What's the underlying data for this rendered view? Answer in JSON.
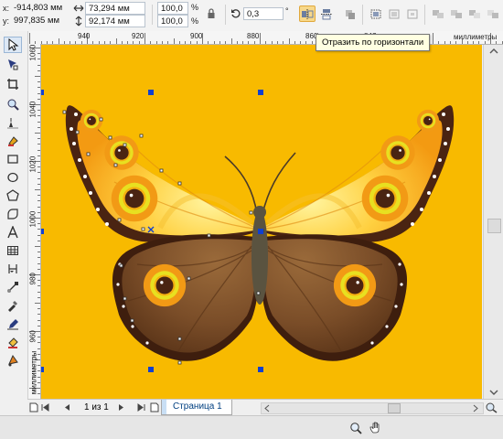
{
  "propbar": {
    "x_label": "x:",
    "x_value": "-914,803 мм",
    "y_label": "y:",
    "y_value": "997,835 мм",
    "width_value": "73,294 мм",
    "height_value": "92,174 мм",
    "scale_x_value": "100,0",
    "scale_y_value": "100,0",
    "percent": "%",
    "rotation_value": "0,3",
    "rotation_unit": "°"
  },
  "tooltip": {
    "text": "Отразить по горизонтали"
  },
  "ruler": {
    "h_ticks": [
      "940",
      "920",
      "900",
      "880",
      "860",
      "840"
    ],
    "units": "миллиметры",
    "v_ticks": [
      "1060",
      "1040",
      "1020",
      "1000",
      "980",
      "960"
    ],
    "v_units": "миллиметры"
  },
  "pagebar": {
    "page_counter": "1 из 1",
    "page_tab": "Страница 1"
  },
  "colors": {
    "canvas": "#f8ba00",
    "selection": "#1040d0",
    "tooltip_bg": "#ffffe1",
    "active_button": "#f7d88a"
  },
  "icons": {
    "toolbox": [
      "pick-tool-icon",
      "shape-tool-icon",
      "crop-tool-icon",
      "zoom-tool-icon",
      "freehand-tool-icon",
      "smart-fill-icon",
      "rectangle-tool-icon",
      "ellipse-tool-icon",
      "polygon-tool-icon",
      "text-tool-icon",
      "table-tool-icon",
      "dimension-tool-icon",
      "connector-tool-icon",
      "eyedropper-tool-icon",
      "outline-pen-icon",
      "fill-tool-icon",
      "interactive-fill-icon"
    ],
    "status": [
      "zoom-icon",
      "pan-hand-icon"
    ]
  }
}
